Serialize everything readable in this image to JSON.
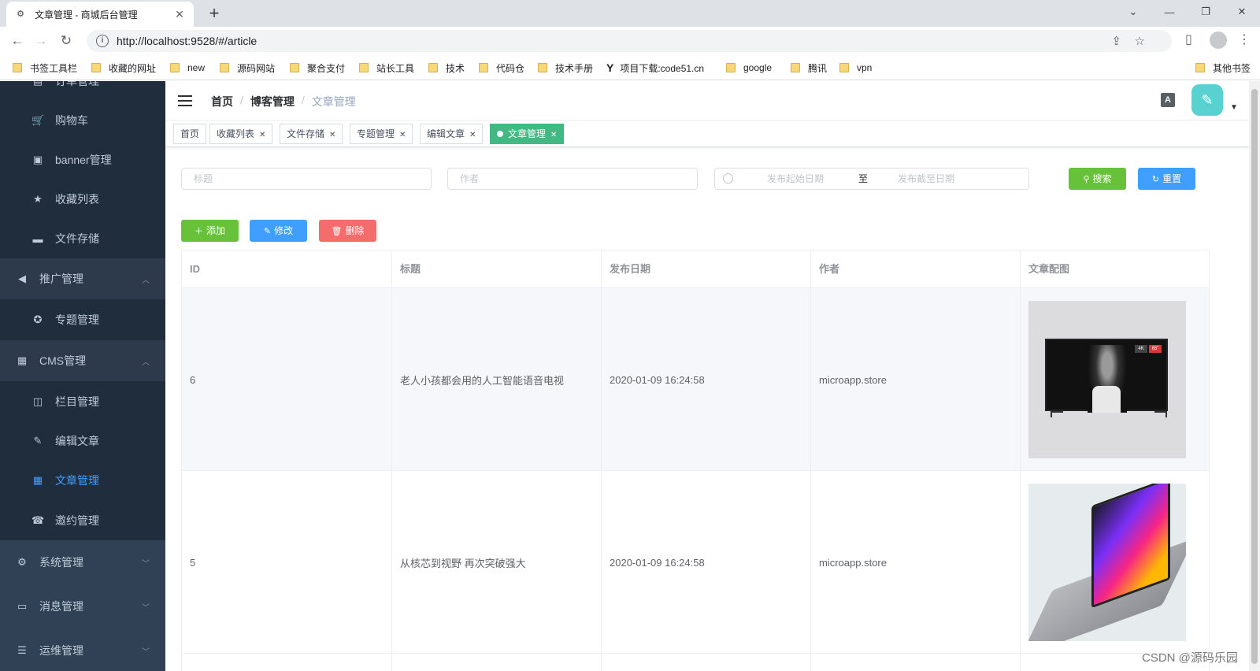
{
  "browser": {
    "tab_title": "文章管理 - 商城后台管理",
    "url": "http://localhost:9528/#/article",
    "bookmarks": [
      "书签工具栏",
      "收藏的网址",
      "new",
      "源码网站",
      "聚合支付",
      "站长工具",
      "技术",
      "代码仓",
      "技术手册",
      "项目下载:code51.cn",
      "google",
      "腾讯",
      "vpn"
    ],
    "other_bookmarks": "其他书签"
  },
  "sidebar": {
    "items": [
      {
        "label": "订单管理",
        "icon": "order-icon"
      },
      {
        "label": "购物车",
        "icon": "cart-icon"
      },
      {
        "label": "banner管理",
        "icon": "ad-icon"
      },
      {
        "label": "收藏列表",
        "icon": "star-icon"
      },
      {
        "label": "文件存储",
        "icon": "folder-icon"
      },
      {
        "label": "推广管理",
        "icon": "megaphone-icon"
      },
      {
        "label": "专题管理",
        "icon": "star-circle-icon"
      },
      {
        "label": "CMS管理",
        "icon": "document-icon"
      },
      {
        "label": "栏目管理",
        "icon": "book-icon"
      },
      {
        "label": "编辑文章",
        "icon": "edit-icon"
      },
      {
        "label": "文章管理",
        "icon": "document-icon"
      },
      {
        "label": "邀约管理",
        "icon": "phone-icon"
      },
      {
        "label": "系统管理",
        "icon": "gear-icon"
      },
      {
        "label": "消息管理",
        "icon": "message-icon"
      },
      {
        "label": "运维管理",
        "icon": "ops-icon"
      }
    ]
  },
  "navbar": {
    "breadcrumb": [
      "首页",
      "博客管理",
      "文章管理"
    ]
  },
  "tags": [
    {
      "label": "首页"
    },
    {
      "label": "收藏列表"
    },
    {
      "label": "文件存储"
    },
    {
      "label": "专题管理"
    },
    {
      "label": "编辑文章"
    },
    {
      "label": "文章管理"
    }
  ],
  "filters": {
    "title_placeholder": "标题",
    "author_placeholder": "作者",
    "date_start_placeholder": "发布起始日期",
    "date_separator": "至",
    "date_end_placeholder": "发布截至日期",
    "search_label": "搜索",
    "reset_label": "重置"
  },
  "actions": {
    "add_label": "添加",
    "edit_label": "修改",
    "delete_label": "删除"
  },
  "table": {
    "columns": [
      "ID",
      "标题",
      "发布日期",
      "作者",
      "文章配图"
    ],
    "rows": [
      {
        "id": "6",
        "title": "老人小孩都会用的人工智能语音电视",
        "date": "2020-01-09 16:24:58",
        "author": "microapp.store"
      },
      {
        "id": "5",
        "title": "从核芯到视野 再次突破强大",
        "date": "2020-01-09 16:24:58",
        "author": "microapp.store"
      }
    ]
  },
  "watermark": "CSDN @源码乐园"
}
